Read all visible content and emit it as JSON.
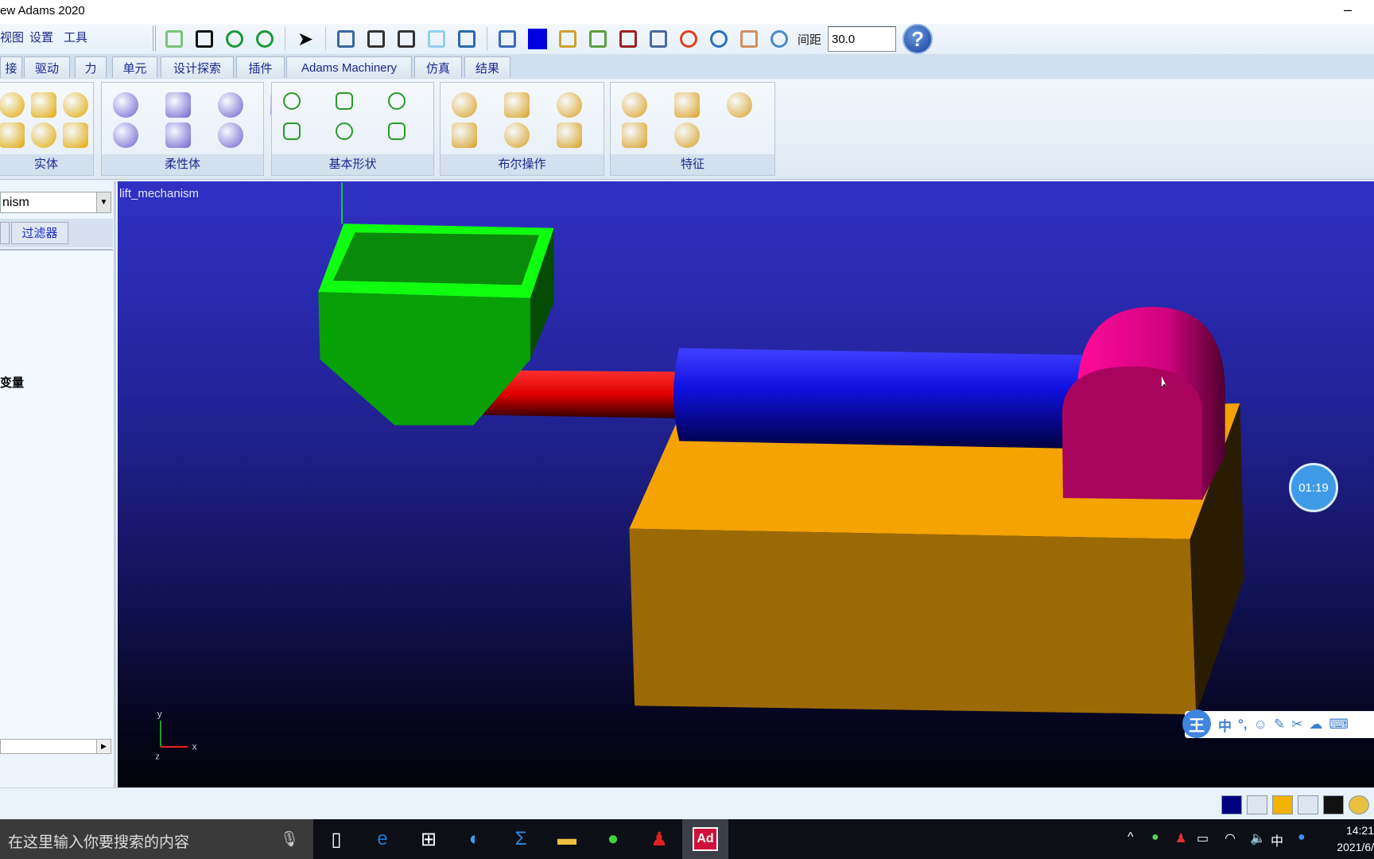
{
  "window": {
    "title": "ew Adams 2020",
    "minimize": "–"
  },
  "menu": [
    "视图",
    "设置",
    "工具"
  ],
  "toolbar": {
    "icons": [
      "new-model-icon",
      "save-icon",
      "redo-icon",
      "undo-icon",
      "select-arrow-icon",
      "front-view-icon",
      "iso-view-icon",
      "side-view-icon",
      "shaded-cube-icon",
      "coordinate-axes-icon",
      "grid-points-icon",
      "background-color-icon",
      "render-mode-icon",
      "fit-view-icon",
      "fit-all-icon",
      "zoom-box-icon",
      "center-target-icon",
      "rotate-icon",
      "pan-hand-icon",
      "zoom-magnifier-icon"
    ],
    "spacing_label": "间距",
    "spacing_value": "30.0",
    "help": "?"
  },
  "tabs": [
    "接",
    "驱动",
    "力",
    "单元",
    "设计探索",
    "插件",
    "Adams Machinery",
    "仿真",
    "结果"
  ],
  "ribbon": [
    {
      "label": "实体",
      "icons": [
        "sphere-icon",
        "frustum-icon",
        "torus-icon",
        "extrusion-icon",
        "revolution-icon",
        "plate-icon"
      ]
    },
    {
      "label": "柔性体",
      "icons": [
        "flex-body-icon",
        "flex-swap-icon",
        "flex-beam-icon",
        "flex-link-icon",
        "flex-rigid-icon",
        "flex-convert-icon",
        "flex-edit-icon"
      ]
    },
    {
      "label": "基本形状",
      "icons": [
        "point-icon",
        "marker-icon",
        "polyline-icon",
        "arc-icon",
        "spline-xyz-icon",
        "outline-icon"
      ]
    },
    {
      "label": "布尔操作",
      "icons": [
        "union-icon",
        "merge-icon",
        "intersect-icon",
        "cut-icon",
        "split-icon",
        "chain-icon"
      ]
    },
    {
      "label": "特征",
      "icons": [
        "chamfer-icon",
        "fillet-icon",
        "hole-icon",
        "boss-icon",
        "hollow-icon"
      ]
    }
  ],
  "left_panel": {
    "model_combo": "nism",
    "filter_tab": "过滤器",
    "tree_item": "变量"
  },
  "viewport": {
    "model_name": "lift_mechanism",
    "axis_x": "x",
    "axis_y": "y",
    "axis_z": "z",
    "timer": "01:19"
  },
  "ime": {
    "logo": "王",
    "items": [
      "中",
      "°,",
      "☺",
      "✎",
      "✂",
      "☁",
      "⌨"
    ]
  },
  "statusbar": {
    "icons": [
      "background-color-icon",
      "triad-icon",
      "part-color-icon",
      "grid-icon",
      "shadow-icon",
      "globe-icon"
    ]
  },
  "taskbar": {
    "search_placeholder": "在这里输入你要搜索的内容",
    "apps": [
      "task-view-icon",
      "edge-icon",
      "store-icon",
      "browser-icon",
      "sigma-icon",
      "file-explorer-icon",
      "wechat-icon",
      "qq-icon",
      "adams-icon"
    ],
    "adams_label": "Ad",
    "tray": [
      "^",
      "中"
    ],
    "time": "14:21",
    "date": "2021/6/"
  },
  "colors": {
    "bucket": "#0aa00a",
    "rod": "#e01010",
    "cylinder": "#1515e8",
    "base": "#f5a300",
    "cap": "#e0068a",
    "viewport_top": "#2f31c4"
  }
}
